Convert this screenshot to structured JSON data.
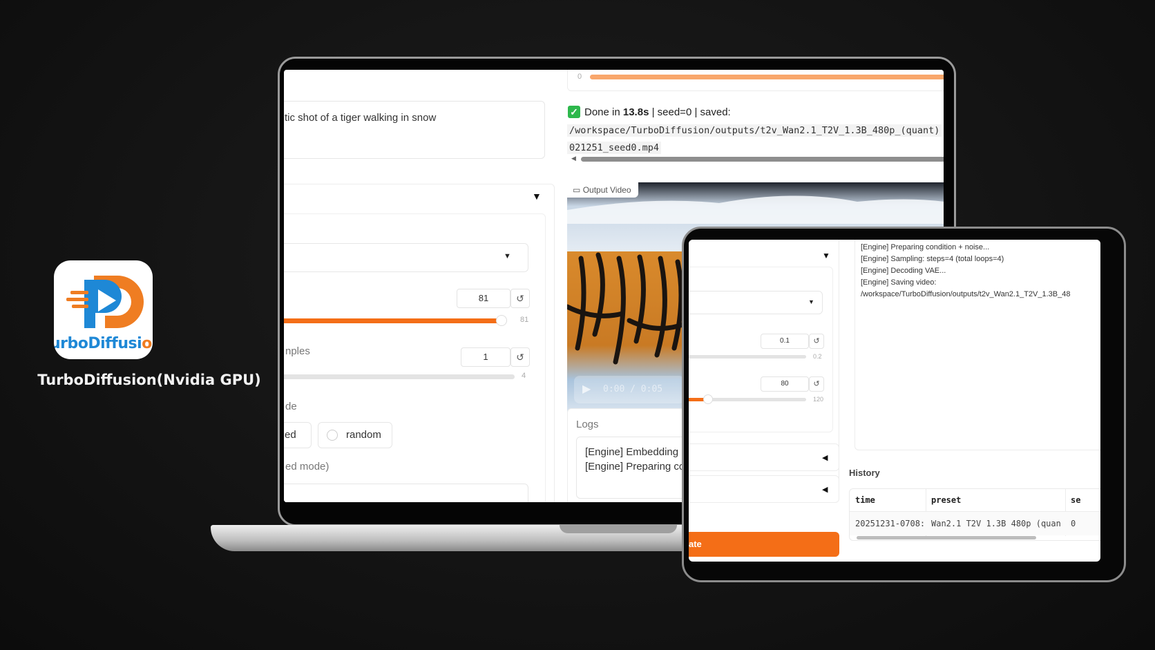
{
  "app": {
    "name": "TurboDiffusion(Nvidia GPU)",
    "icon_text_main": "urboDiffusi",
    "icon_text_tail": "o",
    "colors": {
      "blue": "#1e88d6",
      "orange": "#ef7d22"
    }
  },
  "laptop": {
    "progress": {
      "label": "0",
      "value": 0.99
    },
    "prompt": {
      "value": "tic shot of a tiger walking in snow"
    },
    "frames": {
      "value": "81",
      "max_label": "81",
      "fraction": 0.98
    },
    "samples": {
      "label": "nples",
      "value": "1",
      "max_label": "4",
      "fraction": 0.0
    },
    "seed_mode": {
      "label": "de",
      "options": [
        "ed",
        "random"
      ]
    },
    "seed_hint": "ed mode)",
    "status": {
      "check_icon": "check-mark-icon",
      "done_prefix": "Done in ",
      "done_time": "13.8s",
      "done_suffix": " | seed=0 | saved:",
      "path_line1": "/workspace/TurboDiffusion/outputs/t2v_Wan2.1_T2V_1.3B_480p_(quant)",
      "path_line2": "021251_seed0.mp4"
    },
    "video": {
      "label": "Output Video",
      "time": "0:00 / 0:05"
    },
    "logs": {
      "title": "Logs",
      "lines": [
        "[Engine] Embedding p",
        "[Engine] Preparing cor"
      ]
    }
  },
  "tablet": {
    "log_lines": [
      "[Engine] Preparing condition + noise...",
      "[Engine] Sampling: steps=4 (total loops=4)",
      "[Engine] Decoding VAE...",
      "[Engine] Saving video:",
      "/workspace/TurboDiffusion/outputs/t2v_Wan2.1_T2V_1.3B_48"
    ],
    "slider1": {
      "value": "0.1",
      "max_label": "0.2",
      "fraction": 0.0
    },
    "slider2": {
      "value": "80",
      "max_label": "120",
      "fraction": 0.2
    },
    "generate_label": "ate",
    "history": {
      "title": "History",
      "columns": [
        "time",
        "preset",
        "se"
      ],
      "rows": [
        [
          "20251231-0708:",
          "Wan2.1 T2V 1.3B 480p (quan",
          "0"
        ]
      ]
    }
  }
}
